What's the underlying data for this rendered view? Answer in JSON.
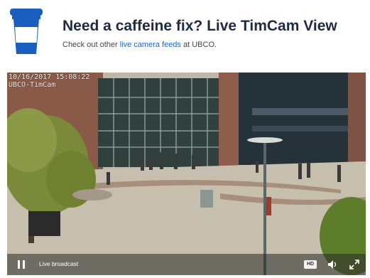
{
  "header": {
    "title": "Need a caffeine fix? Live TimCam View",
    "subtitle_before": "Check out other ",
    "subtitle_link": "live camera feeds",
    "subtitle_after": " at UBCO."
  },
  "video": {
    "timestamp": "10/16/2017 15:08:22",
    "camera_name": "UBCO-TimCam"
  },
  "controls": {
    "live_label": "Live broadcast",
    "hd_label": "HD"
  },
  "colors": {
    "cup_blue": "#1a5fc0",
    "link_blue": "#1a66c9",
    "title_text": "#1f2a44"
  },
  "icons": {
    "logo": "coffee-cup-icon",
    "pause": "pause-icon",
    "volume": "volume-icon",
    "fullscreen": "fullscreen-icon"
  }
}
